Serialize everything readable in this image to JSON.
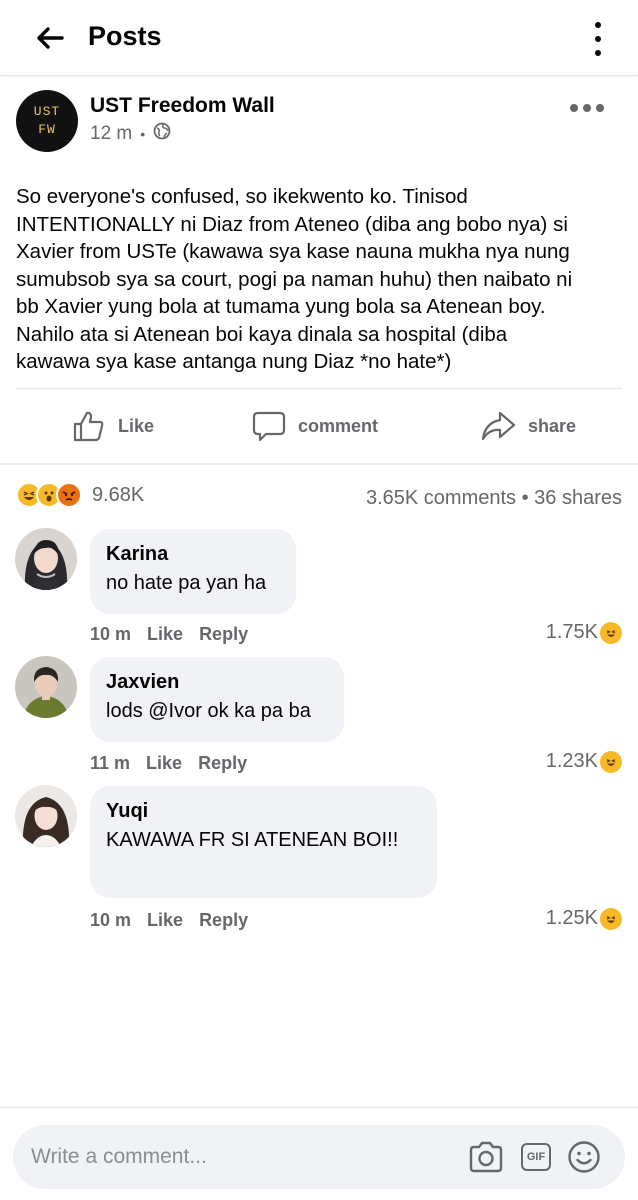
{
  "header": {
    "title": "Posts"
  },
  "post": {
    "page_name": "UST Freedom Wall",
    "avatar_line1": "UST",
    "avatar_line2": "FW",
    "time": "12 m",
    "separator": "•",
    "privacy_icon": "globe-icon",
    "text": "So everyone's confused, so ikekwento ko. Tinisod\nINTENTIONALLY ni Diaz from Ateneo (diba ang bobo nya) si\nXavier from USTe (kawawa sya kase nauna mukha nya nung\nsumubsob sya sa court, pogi pa naman huhu) then naibato ni\nbb Xavier yung bola at tumama yung bola sa Atenean boy.\nNahilo ata si Atenean boi kaya dinala sa hospital (diba\nkawawa sya kase antanga nung Diaz *no hate*)"
  },
  "actions": {
    "like_label": "Like",
    "comment_label": "comment",
    "share_label": "share"
  },
  "summary": {
    "reactions": [
      "haha",
      "wow",
      "angry"
    ],
    "reaction_count": "9.68K",
    "stats": "3.65K comments • 36 shares"
  },
  "comments": [
    {
      "name": "Karina",
      "text": "no hate pa yan ha",
      "time": "10 m",
      "like": "Like",
      "reply": "Reply",
      "reaction_count": "1.75K"
    },
    {
      "name": "Jaxvien",
      "text": "lods @Ivor ok ka pa ba",
      "time": "11 m",
      "like": "Like",
      "reply": "Reply",
      "reaction_count": "1.23K"
    },
    {
      "name": "Yuqi",
      "text": "KAWAWA FR SI ATENEAN BOI!!",
      "time": "10 m",
      "like": "Like",
      "reply": "Reply",
      "reaction_count": "1.25K"
    }
  ],
  "composer": {
    "placeholder": "Write a comment...",
    "gif_label": "GIF"
  },
  "colors": {
    "text": "#050505",
    "secondary": "#65676b",
    "bubble": "#f0f2f5",
    "haha": "#f7b928",
    "angry": "#e9710f"
  }
}
